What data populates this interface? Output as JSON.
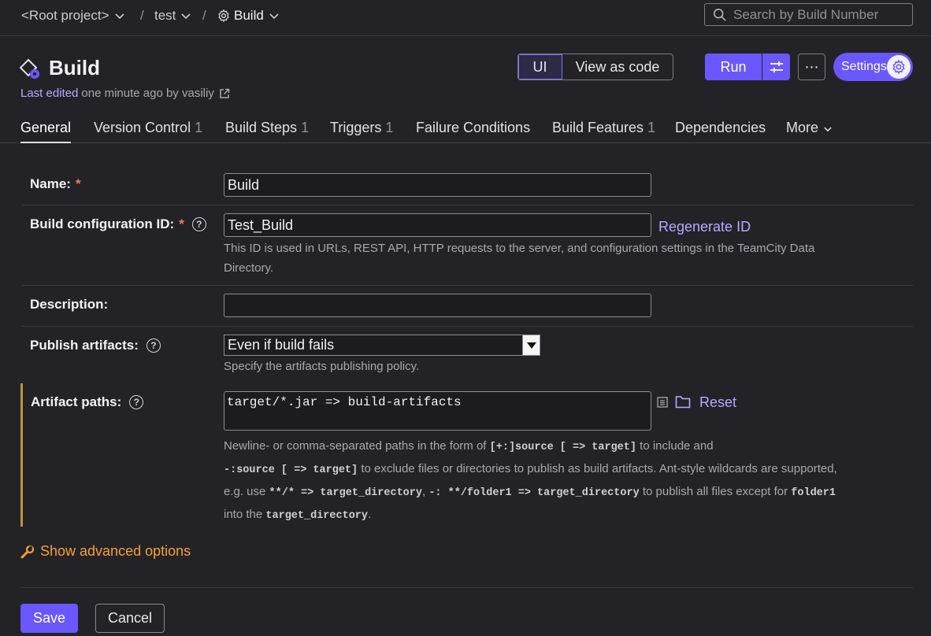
{
  "breadcrumb": {
    "root": "<Root project>",
    "project": "test",
    "build": "Build"
  },
  "search": {
    "placeholder": "Search by Build Number"
  },
  "header": {
    "title": "Build",
    "last_edited_label": "Last edited",
    "last_edited_info": "one minute ago by vasiliy"
  },
  "toolbar": {
    "ui_label": "UI",
    "view_as_code_label": "View as code",
    "run_label": "Run",
    "more_label": "⋯",
    "settings_label": "Settings"
  },
  "tabs": [
    {
      "label": "General",
      "count": ""
    },
    {
      "label": "Version Control",
      "count": "1"
    },
    {
      "label": "Build Steps",
      "count": "1"
    },
    {
      "label": "Triggers",
      "count": "1"
    },
    {
      "label": "Failure Conditions",
      "count": ""
    },
    {
      "label": "Build Features",
      "count": "1"
    },
    {
      "label": "Dependencies",
      "count": ""
    },
    {
      "label": "More",
      "count": ""
    }
  ],
  "form": {
    "name": {
      "label": "Name:",
      "required": "*",
      "value": "Build"
    },
    "config_id": {
      "label": "Build configuration ID:",
      "required": "*",
      "value": "Test_Build",
      "regenerate_label": "Regenerate ID",
      "hint": "This ID is used in URLs, REST API, HTTP requests to the server, and configuration settings in the TeamCity Data Directory."
    },
    "description": {
      "label": "Description:",
      "value": ""
    },
    "publish_artifacts": {
      "label": "Publish artifacts:",
      "selected": "Even if build fails",
      "hint": "Specify the artifacts publishing policy."
    },
    "artifact_paths": {
      "label": "Artifact paths:",
      "value": "target/*.jar => build-artifacts",
      "reset_label": "Reset",
      "hint": {
        "t1": "Newline- or comma-separated paths in the form of",
        "c1": "[+:]source [ => target]",
        "t2": "to include and",
        "c2": "-:source [ => target]",
        "t3": "to exclude files or directories to publish as build artifacts. Ant-style wildcards are supported, e.g. use",
        "c3": "**/* => target_directory",
        "t4": ",",
        "c4": "-: **/folder1 => target_directory",
        "t5": "to publish all files except for",
        "c5": "folder1",
        "t6": "into the",
        "c6": "target_directory",
        "t7": "."
      }
    },
    "advanced_label": "Show advanced options"
  },
  "actions": {
    "save_label": "Save",
    "cancel_label": "Cancel"
  },
  "colors": {
    "accent": "#6b57ff",
    "link": "#b7a9ff",
    "warning": "#f5a03a",
    "required": "#ff6e6e"
  }
}
